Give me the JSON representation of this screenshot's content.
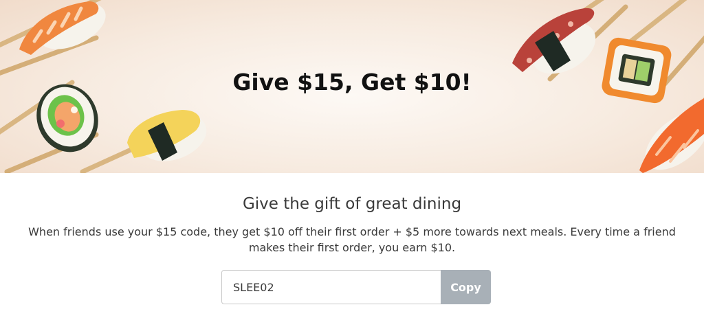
{
  "hero": {
    "title": "Give $15, Get $10!",
    "image_icons": [
      "shrimp-nigiri-icon",
      "california-roll-icon",
      "tamago-nigiri-icon",
      "octopus-nigiri-icon",
      "tobiko-roll-icon",
      "salmon-nigiri-icon"
    ]
  },
  "content": {
    "subtitle": "Give the gift of great dining",
    "description": "When friends use your $15 code, they get $10 off their first order + $5 more towards next meals. Every time a friend makes their first order, you earn $10.",
    "referral": {
      "code": "SLEE02",
      "copy_label": "Copy"
    }
  },
  "colors": {
    "copy_button": "#a8b0b7",
    "hero_background": "#f5e6d8",
    "title": "#111111"
  }
}
